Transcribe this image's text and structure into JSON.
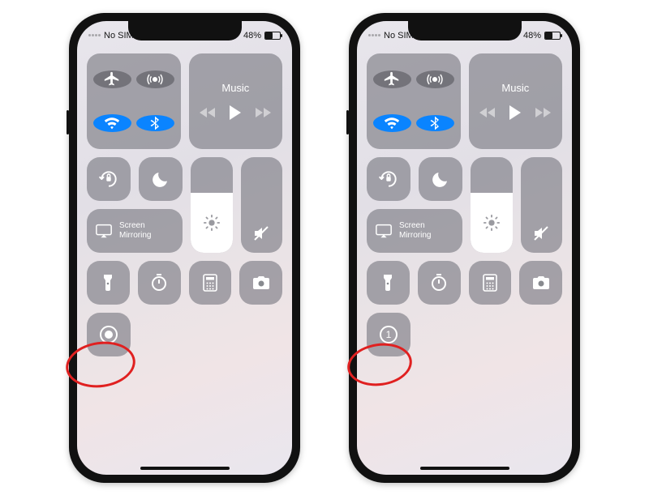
{
  "status": {
    "carrier": "No SIM",
    "battery_pct": "48%"
  },
  "music": {
    "label": "Music"
  },
  "mirror": {
    "line1": "Screen",
    "line2": "Mirroring"
  },
  "record": {
    "countdown": "1"
  },
  "icons": {
    "airplane": "airplane-icon",
    "airdrop": "airdrop-icon",
    "wifi": "wifi-icon",
    "bluetooth": "bluetooth-icon",
    "lock": "orientation-lock-icon",
    "dnd": "do-not-disturb-icon",
    "mirror": "screen-mirroring-icon",
    "brightness": "brightness-icon",
    "volume": "mute-icon",
    "flashlight": "flashlight-icon",
    "timer": "timer-icon",
    "calculator": "calculator-icon",
    "camera": "camera-icon",
    "record": "screen-record-icon"
  }
}
